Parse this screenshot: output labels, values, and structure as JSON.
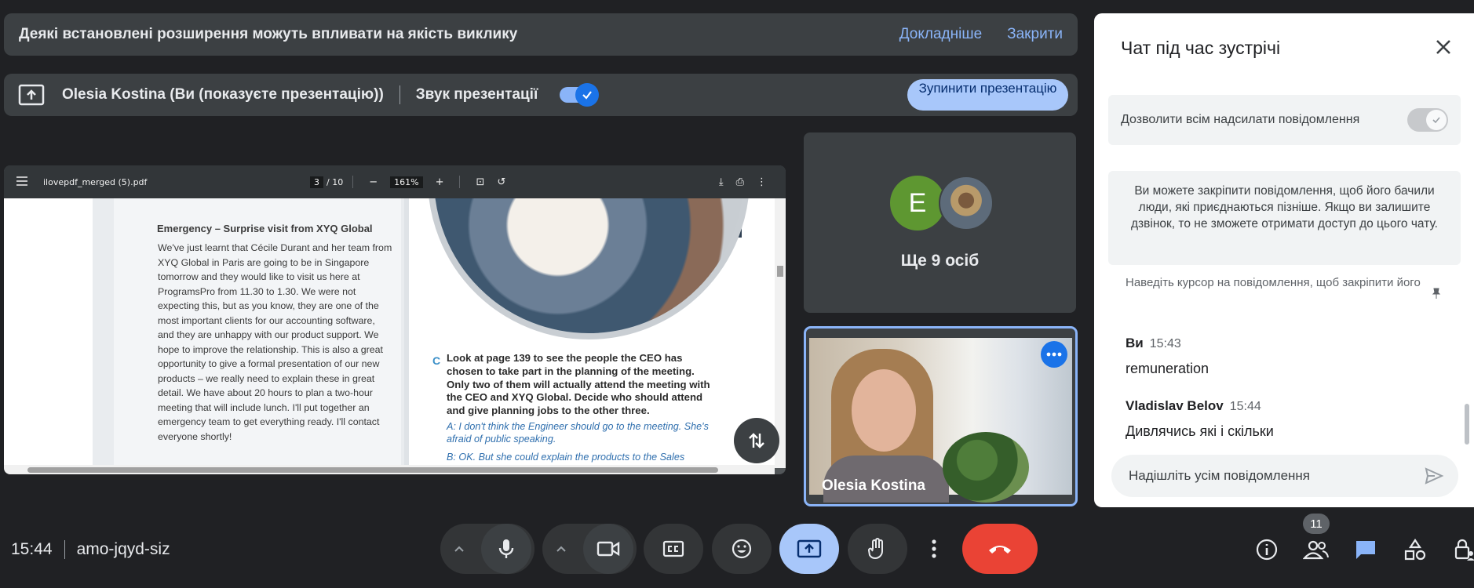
{
  "notice": {
    "text": "Деякі встановлені розширення можуть впливати на якість виклику",
    "learn_more": "Докладніше",
    "close": "Закрити"
  },
  "presentation": {
    "presenter": "Olesia Kostina (Ви (показуєте презентацію))",
    "audio_label": "Звук презентації",
    "audio_enabled": true,
    "stop_button": "Зупинити презентацію"
  },
  "pdf_viewer": {
    "filename": "ilovepdf_merged (5).pdf",
    "current_page": "3",
    "total_pages": "/ 10",
    "zoom": "161%",
    "page": {
      "heading": "Emergency – Surprise visit from XYQ Global",
      "body": "We've just learnt that Cécile Durant and her team from XYQ Global in Paris are going to be in Singapore tomorrow and they would like to visit us here at ProgramsPro from 11.30 to 1.30. We were not expecting this, but as you know, they are one of the most important clients for our accounting software, and they are unhappy with our product support. We hope to improve the relationship. This is also a great opportunity to give a formal presentation of our new products – we really need to explain these in great detail. We have about 20 hours to plan a two-hour meeting that will include lunch. I'll put together an emergency team to get everything ready. I'll contact everyone shortly!",
      "task_letter": "C",
      "task": "Look at page 139 to see the people the CEO has chosen to take part in the planning of the meeting. Only two of them will actually attend the meeting with the CEO and XYQ Global. Decide who should attend and give planning jobs to the other three.",
      "answer_a": "A: I don't think the Engineer should go to the meeting. She's afraid of public speaking.",
      "answer_b": "B: OK. But she could explain the products to the Sales"
    }
  },
  "tiles": {
    "others_avatar_letter": "E",
    "others_label": "Ще 9 осіб",
    "self_name": "Olesia Kostina"
  },
  "chat": {
    "title": "Чат під час зустрічі",
    "allow_label": "Дозволити всім надсилати повідомлення",
    "allow_enabled": true,
    "pin_info": "Ви можете закріпити повідомлення, щоб його бачили люди, які приєднаються пізніше. Якщо ви залишите дзвінок, то не зможете отримати доступ до цього чату.",
    "hint": "Наведіть курсор на повідомлення, щоб закріпити його",
    "messages": [
      {
        "sender": "Ви",
        "time": "15:43",
        "text": "remuneration"
      },
      {
        "sender": "Vladislav Belov",
        "time": "15:44",
        "text": "Дивлячись які і скільки"
      }
    ],
    "input_placeholder": "Надішліть усім повідомлення"
  },
  "bottom": {
    "time": "15:44",
    "meeting_code": "amo-jqyd-siz",
    "participants_count": "11"
  },
  "colors": {
    "accent": "#8ab4f8",
    "present_active": "#a8c7fa",
    "end_call": "#ea4335"
  }
}
